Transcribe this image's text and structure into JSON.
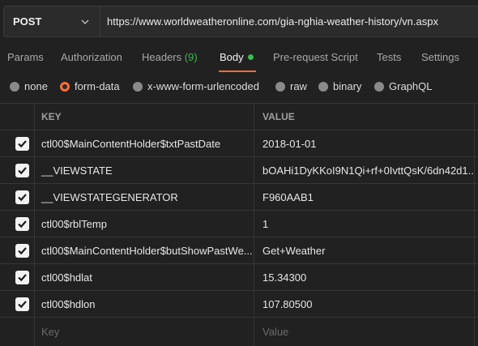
{
  "request": {
    "method": "POST",
    "url": "https://www.worldweatheronline.com/gia-nghia-weather-history/vn.aspx"
  },
  "tabs": [
    {
      "label": "Params"
    },
    {
      "label": "Authorization"
    },
    {
      "label": "Headers",
      "count": "(9)"
    },
    {
      "label": "Body"
    },
    {
      "label": "Pre-request Script"
    },
    {
      "label": "Tests"
    },
    {
      "label": "Settings"
    }
  ],
  "body_types": [
    {
      "label": "none",
      "selected": false
    },
    {
      "label": "form-data",
      "selected": true
    },
    {
      "label": "x-www-form-urlencoded",
      "selected": false
    },
    {
      "label": "raw",
      "selected": false
    },
    {
      "label": "binary",
      "selected": false
    },
    {
      "label": "GraphQL",
      "selected": false
    }
  ],
  "table": {
    "headers": {
      "key": "KEY",
      "value": "VALUE"
    },
    "rows": [
      {
        "key": "ctl00$MainContentHolder$txtPastDate",
        "value": "2018-01-01",
        "checked": true
      },
      {
        "key": "__VIEWSTATE",
        "value": "bOAHi1DyKKoI9N1Qi+rf+0IvttQsK/6dn42d1...",
        "checked": true
      },
      {
        "key": "__VIEWSTATEGENERATOR",
        "value": "F960AAB1",
        "checked": true
      },
      {
        "key": "ctl00$rblTemp",
        "value": "1",
        "checked": true
      },
      {
        "key": "ctl00$MainContentHolder$butShowPastWe...",
        "value": "Get+Weather",
        "checked": true
      },
      {
        "key": "ctl00$hdlat",
        "value": "15.34300",
        "checked": true
      },
      {
        "key": "ctl00$hdlon",
        "value": "107.80500",
        "checked": true
      }
    ],
    "new_row": {
      "key_placeholder": "Key",
      "value_placeholder": "Value"
    }
  },
  "colors": {
    "accent": "#ff6c37",
    "active_dot": "#3fb950",
    "background": "#212121"
  }
}
